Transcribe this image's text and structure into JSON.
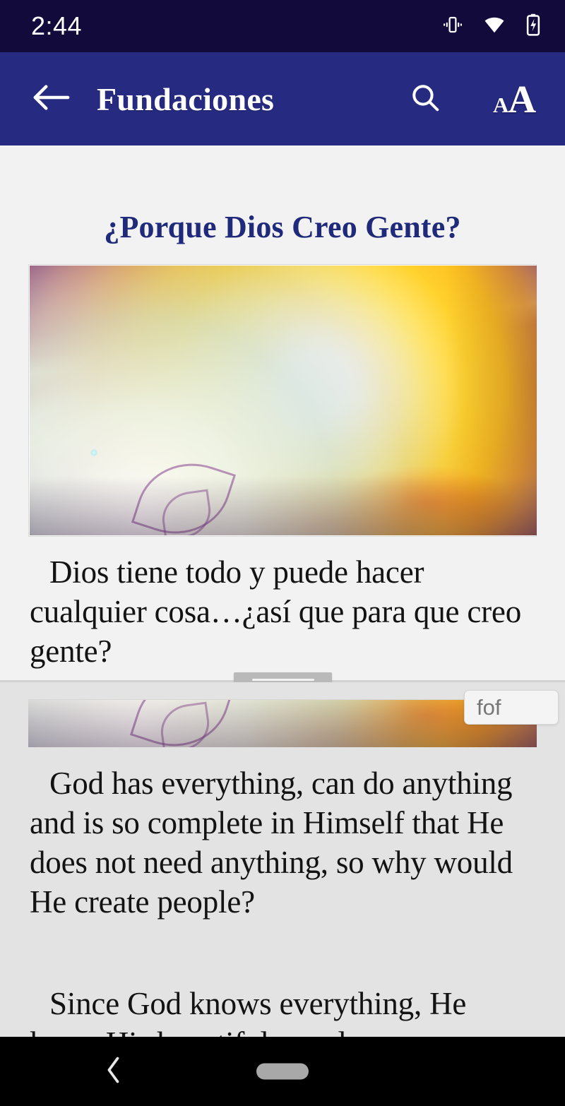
{
  "status_bar": {
    "time": "2:44",
    "icons": [
      "vibrate-icon",
      "wifi-icon",
      "battery-charging-icon"
    ],
    "background": "#120a3a"
  },
  "app_bar": {
    "title": "Fundaciones",
    "background": "#262a80",
    "back_icon": "back-arrow-icon",
    "actions": [
      {
        "name": "search-icon",
        "label": "Search"
      },
      {
        "name": "font-size-icon",
        "small_a": "A",
        "big_a": "A"
      }
    ]
  },
  "content": {
    "article_title": "¿Porque Dios Creo Gente?",
    "title_color": "#1f2a7a",
    "illustration_alt": "Glowing golden orb held in hands with purple background and light rays",
    "spanish_paragraph": "Dios tiene todo y puede hacer cualquier cosa…¿así que para que creo gente?",
    "english_paragraph_1": "God has everything, can do anything and is so complete in Himself that He does not need anything, so why would He create people?",
    "english_paragraph_2": "Since God knows everything, He knew His beautiful people",
    "top_pane_background": "#f2f2f2",
    "bottom_pane_background": "#e3e3e3"
  },
  "splitter": {
    "name": "pane-drag-handle",
    "grip_lines": 2
  },
  "tooltip": {
    "text": "fof",
    "text_color": "#767676",
    "background": "#f4f4f4"
  },
  "nav_bar": {
    "background": "#000000",
    "back_glyph": "‹",
    "items": [
      "nav-back-button",
      "nav-home-indicator"
    ]
  }
}
